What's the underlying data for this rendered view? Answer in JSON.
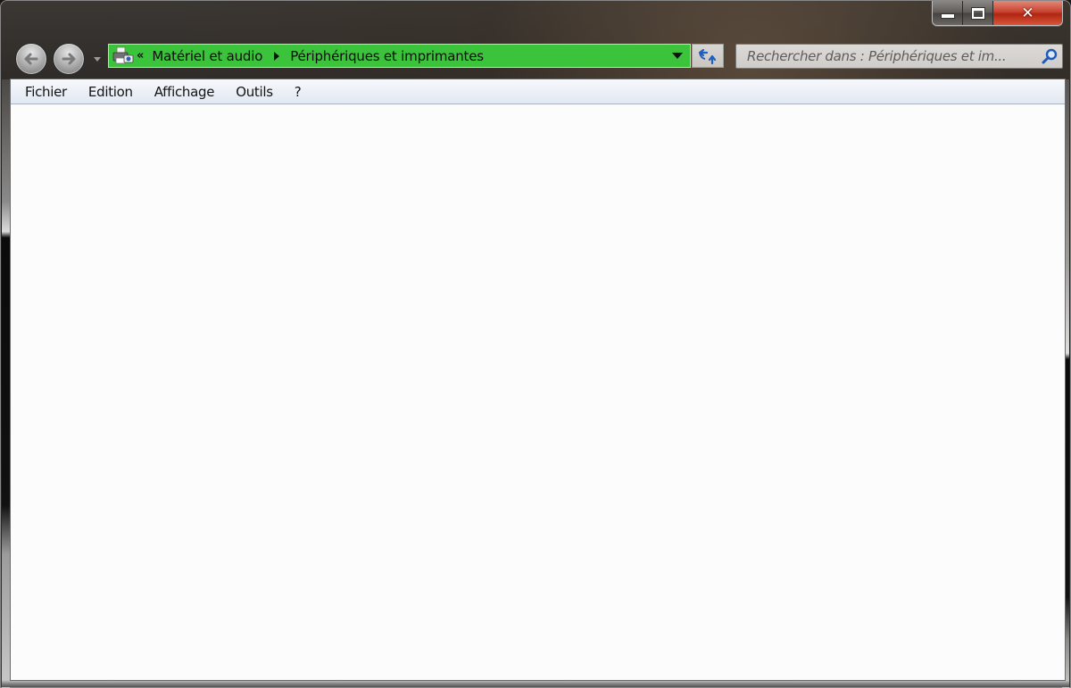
{
  "window": {
    "caption_buttons": {
      "minimize_icon": "minimize-icon",
      "maximize_icon": "maximize-icon",
      "close_glyph": "✕"
    }
  },
  "navigation": {
    "back_icon": "back-arrow-icon",
    "forward_icon": "forward-arrow-icon",
    "recent_pages_icon": "chevron-down-icon"
  },
  "address_bar": {
    "location_icon": "devices-printers-icon",
    "overflow_glyph": "«",
    "breadcrumbs": [
      {
        "label": "Matériel et audio"
      },
      {
        "label": "Périphériques et imprimantes"
      }
    ],
    "highlight_color": "#3bc33b",
    "dropdown_icon": "chevron-down-icon",
    "refresh_icon": "refresh-icon"
  },
  "search": {
    "placeholder": "Rechercher dans : Périphériques et im...",
    "value": "",
    "icon": "search-icon"
  },
  "menu_bar": {
    "items": [
      {
        "label": "Fichier"
      },
      {
        "label": "Edition"
      },
      {
        "label": "Affichage"
      },
      {
        "label": "Outils"
      },
      {
        "label": "?"
      }
    ]
  }
}
